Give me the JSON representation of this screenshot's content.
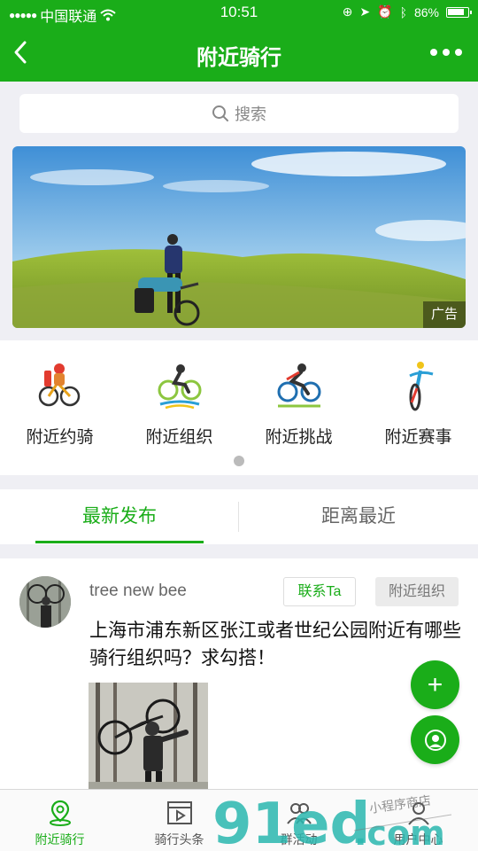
{
  "status_bar": {
    "carrier": "中国联通",
    "time": "10:51",
    "battery": "86%"
  },
  "nav": {
    "title": "附近骑行",
    "back_icon": "back-arrow-icon",
    "more_icon": "more-dots-icon"
  },
  "search": {
    "placeholder": "搜索"
  },
  "banner": {
    "ad_label": "广告"
  },
  "entries": [
    {
      "label": "附近约骑",
      "icon": "group-ride-icon"
    },
    {
      "label": "附近组织",
      "icon": "cycling-org-icon"
    },
    {
      "label": "附近挑战",
      "icon": "challenge-icon"
    },
    {
      "label": "附近赛事",
      "icon": "race-icon"
    }
  ],
  "tabs": [
    {
      "label": "最新发布",
      "active": true
    },
    {
      "label": "距离最近",
      "active": false
    }
  ],
  "post": {
    "user": "tree new bee",
    "contact_label": "联系Ta",
    "badge": "附近组织",
    "text": "上海市浦东新区张江或者世纪公园附近有哪些骑行组织吗？求勾搭！"
  },
  "fab": {
    "add_label": "+"
  },
  "tabbar": [
    {
      "label": "附近骑行",
      "icon": "location-pin-icon",
      "active": true
    },
    {
      "label": "骑行头条",
      "icon": "video-play-icon",
      "active": false
    },
    {
      "label": "群活动",
      "icon": "group-users-icon",
      "active": false
    },
    {
      "label": "用户中心",
      "icon": "user-icon",
      "active": false
    }
  ],
  "watermark": {
    "text": "91ed.com",
    "subtext": "小程序商店"
  },
  "colors": {
    "brand_green": "#1aad19",
    "background": "#efeff4"
  }
}
